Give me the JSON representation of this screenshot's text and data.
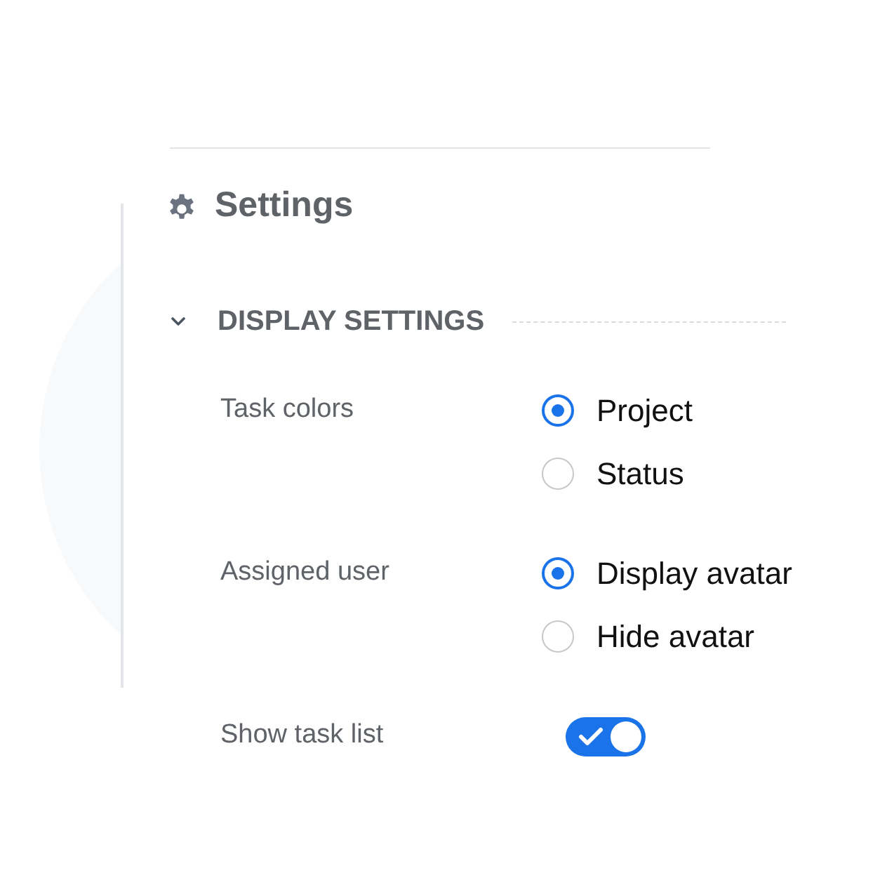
{
  "title": "Settings",
  "section": {
    "title": "DISPLAY SETTINGS",
    "expanded": true
  },
  "settings": [
    {
      "kind": "radio",
      "label": "Task colors",
      "options": [
        {
          "label": "Project",
          "selected": true
        },
        {
          "label": "Status",
          "selected": false
        }
      ]
    },
    {
      "kind": "radio",
      "label": "Assigned user",
      "options": [
        {
          "label": "Display avatar",
          "selected": true
        },
        {
          "label": "Hide avatar",
          "selected": false
        }
      ]
    },
    {
      "kind": "toggle",
      "label": "Show task list",
      "on": true
    }
  ]
}
